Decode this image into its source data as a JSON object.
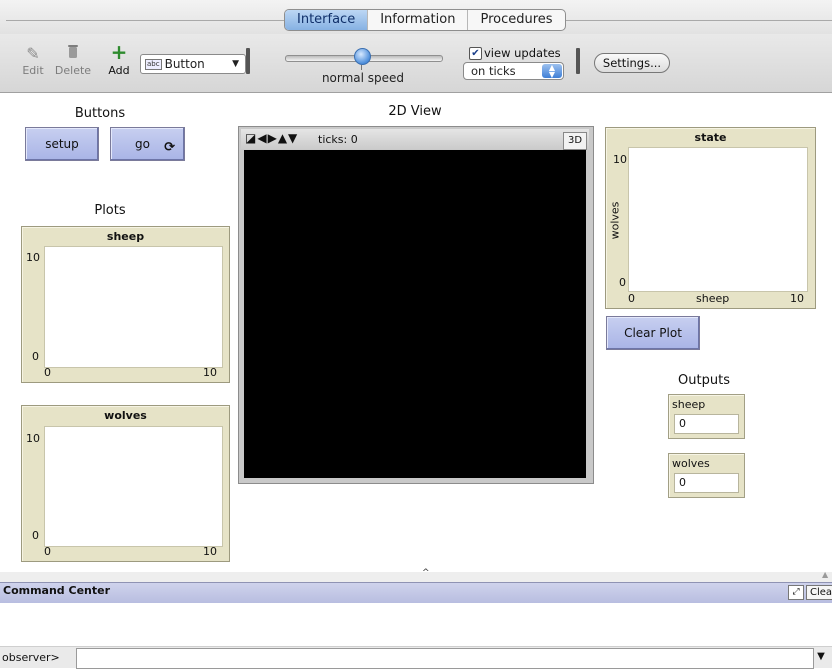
{
  "tabs": [
    {
      "label": "Interface",
      "active": true
    },
    {
      "label": "Information",
      "active": false
    },
    {
      "label": "Procedures",
      "active": false
    }
  ],
  "toolbar": {
    "edit_label": "Edit",
    "delete_label": "Delete",
    "add_label": "Add",
    "widget_type": "Button",
    "widget_badge": "abc",
    "speed_label": "normal speed",
    "speed_value": 0.5,
    "view_updates_label": "view updates",
    "view_updates_checked": true,
    "update_mode": "on ticks",
    "settings_label": "Settings..."
  },
  "interface": {
    "buttons_caption": "Buttons",
    "plots_caption": "Plots",
    "view_caption": "2D View",
    "outputs_caption": "Outputs",
    "setup_label": "setup",
    "go_label": "go",
    "ticks_label": "ticks: 0",
    "three_d_label": "3D",
    "clear_plot_label": "Clear Plot"
  },
  "plots": {
    "sheep": {
      "title": "sheep",
      "ymax": "10",
      "ymin": "0",
      "xmin": "0",
      "xmax": "10"
    },
    "wolves": {
      "title": "wolves",
      "ymax": "10",
      "ymin": "0",
      "xmin": "0",
      "xmax": "10"
    },
    "state": {
      "title": "state",
      "ymax": "10",
      "ymin": "0",
      "xmin": "0",
      "xmax": "10",
      "xlabel": "sheep",
      "ylabel": "wolves"
    }
  },
  "monitors": [
    {
      "label": "sheep",
      "value": "0"
    },
    {
      "label": "wolves",
      "value": "0"
    }
  ],
  "command_center": {
    "title": "Command Center",
    "clear_label": "Clear",
    "prompt": "observer>",
    "input_value": ""
  },
  "colors": {
    "button_widget": "#aab4e6",
    "plot_background": "#e6e3c7",
    "tab_active": "#86b1e3",
    "command_bar": "#c3c8e6",
    "add_icon": "#2e8b2e"
  },
  "icons": {
    "edit": "pencil-icon",
    "delete": "trash-icon",
    "add": "plus-icon",
    "forever": "forever-loop-icon"
  }
}
